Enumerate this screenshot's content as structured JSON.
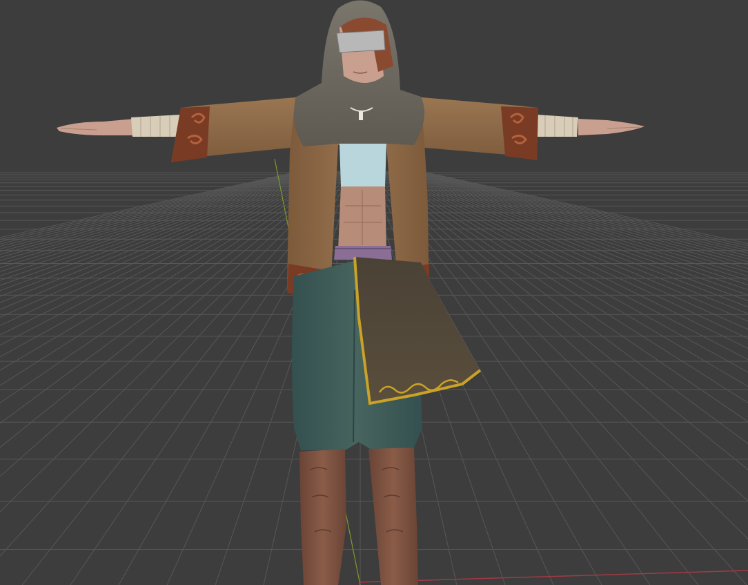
{
  "viewport": {
    "mode": "3d-viewport",
    "background_color": "#3d3d3d",
    "grid_color": "#575757",
    "x_axis_color": "#a23a44",
    "y_axis_color": "#7d9a2e",
    "grid_visible": true
  },
  "model": {
    "pose": "t-pose",
    "parts": [
      "hood",
      "visor",
      "hair",
      "necklace",
      "coat",
      "cuffs",
      "top",
      "belt",
      "skirt-panel",
      "trousers",
      "boots"
    ],
    "colors": {
      "skin": "#c9a090",
      "hood": "#6e6a60",
      "coat": "#8f6b46",
      "coat_trim": "#7a3b24",
      "sleeve_wrap": "#d8cdb8",
      "top": "#b9d6dc",
      "skirt": "#4f4537",
      "skirt_trim": "#c9a227",
      "trousers": "#3e5a5a",
      "boots": "#7a5040",
      "hair": "#8a4a30",
      "visor": "#b8b8b8"
    }
  }
}
